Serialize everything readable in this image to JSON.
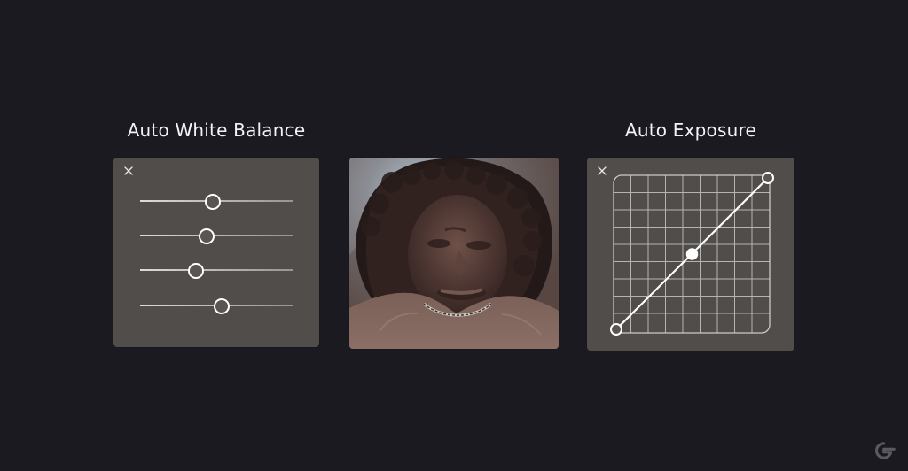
{
  "awb": {
    "title": "Auto White Balance",
    "sliders": [
      {
        "name": "slider-1",
        "value": 0.47
      },
      {
        "name": "slider-2",
        "value": 0.43
      },
      {
        "name": "slider-3",
        "value": 0.36
      },
      {
        "name": "slider-4",
        "value": 0.53
      }
    ]
  },
  "ae": {
    "title": "Auto Exposure"
  },
  "icons": {
    "close": "close-icon",
    "brand": "google-icon"
  }
}
